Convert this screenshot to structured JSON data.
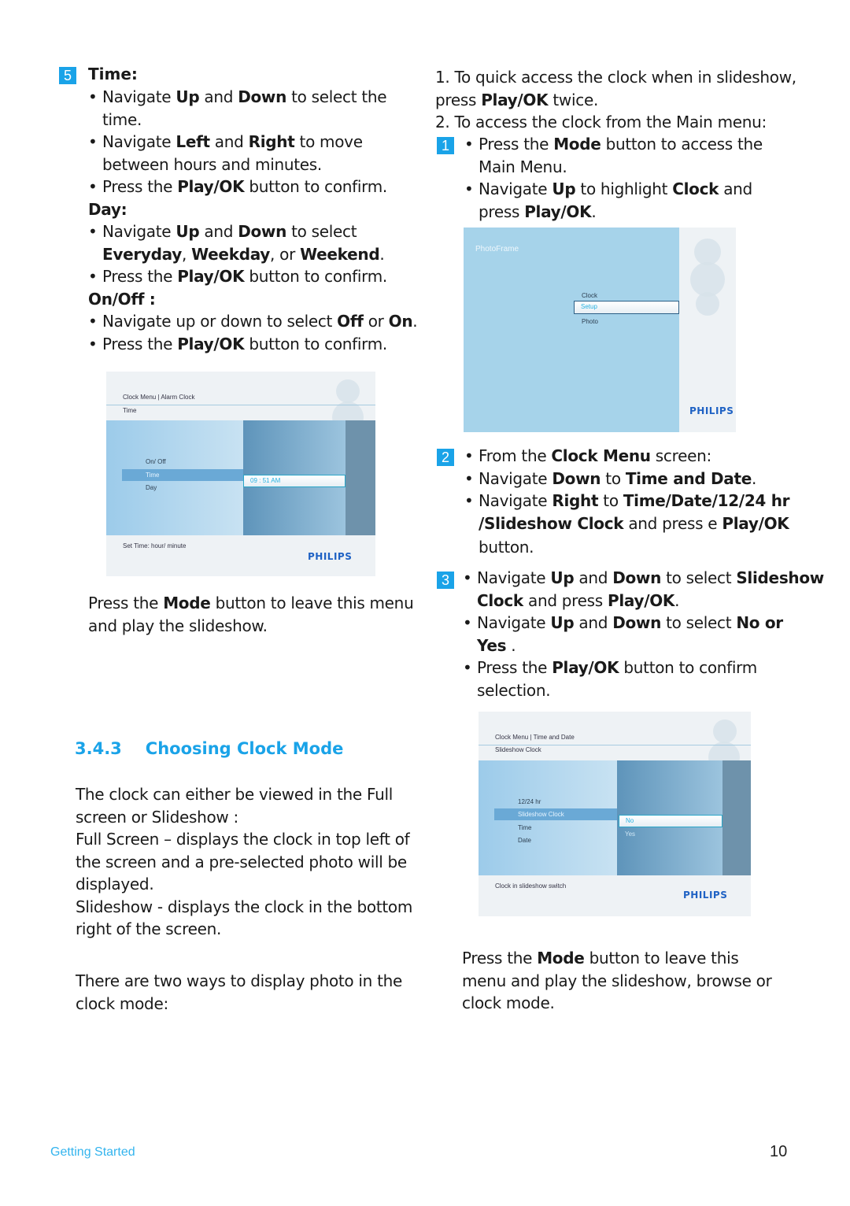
{
  "left": {
    "step5_badge": "5",
    "time_heading": "Time:",
    "time_items": [
      {
        "parts": [
          "Navigate ",
          "Up",
          " and ",
          "Down",
          " to select the"
        ],
        "cont": "time."
      },
      {
        "parts": [
          "Navigate ",
          "Left",
          " and ",
          "Right",
          " to move"
        ],
        "cont": "between hours and minutes."
      },
      {
        "parts": [
          "Press the ",
          "Play/OK",
          " button to confirm."
        ]
      }
    ],
    "day_heading": "Day:",
    "day_items": [
      {
        "parts": [
          "Navigate ",
          "Up",
          " and ",
          "Down",
          " to select"
        ],
        "cont_parts": [
          "Everyday",
          ", ",
          "Weekday",
          ", or ",
          "Weekend",
          "."
        ]
      },
      {
        "parts": [
          "Press the ",
          "Play/OK",
          " button to confirm."
        ]
      }
    ],
    "onoff_heading": "On/Off :",
    "onoff_items": [
      {
        "parts": [
          "Navigate up or down to select ",
          "Off",
          " or ",
          "On",
          "."
        ]
      },
      {
        "parts": [
          "Press the ",
          "Play/OK",
          " button to confirm."
        ]
      }
    ],
    "screen1": {
      "breadcrumb": "Clock Menu | Alarm Clock",
      "subtitle": "Time",
      "menu_items": [
        "On/ Off",
        "Time",
        "Day"
      ],
      "selected_item": "Time",
      "value": "09 : 51 AM",
      "footer": "Set Time: hour/ minute",
      "logo": "PHILIPS"
    },
    "leave_line1_parts": [
      "Press the ",
      "Mode",
      " button to leave this menu"
    ],
    "leave_line2": "and play the slideshow.",
    "section_number": "3.4.3",
    "section_title": "Choosing Clock Mode",
    "para1": [
      "The clock can either be viewed in the Full",
      "screen or Slideshow :",
      "Full Screen – displays the clock in top left of",
      "the screen and a pre-selected photo will be",
      "displayed.",
      "Slideshow  - displays the clock in the bottom",
      "right of the screen."
    ],
    "para2": [
      "There are two ways to display photo in the",
      "clock mode:"
    ]
  },
  "right": {
    "intro1a": "1. To quick access the clock when in slideshow,",
    "intro1b_parts": [
      "press ",
      "Play/OK",
      " twice."
    ],
    "intro2": "2. To access the clock from the Main menu:",
    "step1_badge": "1",
    "step1_items": [
      {
        "parts": [
          "Press the ",
          "Mode",
          " button to access the"
        ],
        "cont": "Main Menu."
      },
      {
        "parts": [
          "Navigate ",
          "Up",
          " to highlight ",
          "Clock",
          " and"
        ],
        "cont_parts": [
          "press ",
          "Play/OK",
          "."
        ]
      }
    ],
    "screen2": {
      "title": "PhotoFrame",
      "menu_items": [
        "Clock",
        "Setup",
        "Photo"
      ],
      "selected_item": "Setup",
      "logo": "PHILIPS"
    },
    "step2_badge": "2",
    "step2_items": [
      {
        "parts": [
          "From the ",
          "Clock Menu",
          " screen:"
        ]
      },
      {
        "parts": [
          "Navigate ",
          "Down",
          " to ",
          "Time and Date",
          "."
        ]
      },
      {
        "parts": [
          "Navigate ",
          "Right",
          " to ",
          "Time/Date/12/24 hr"
        ],
        "cont_parts": [
          "/Slideshow Clock",
          " and press e ",
          "Play/OK"
        ],
        "cont2": "button."
      }
    ],
    "step3_badge": "3",
    "step3_items": [
      {
        "parts": [
          "Navigate ",
          "Up",
          " and ",
          "Down",
          " to select ",
          "Slideshow"
        ],
        "cont_parts": [
          "Clock",
          " and press ",
          "Play/OK",
          "."
        ]
      },
      {
        "parts": [
          "Navigate ",
          "Up",
          " and ",
          "Down",
          " to select ",
          "No or"
        ],
        "cont_parts": [
          "Yes",
          " ."
        ]
      },
      {
        "parts": [
          "Press the ",
          "Play/OK",
          " button to confirm"
        ],
        "cont": "selection."
      }
    ],
    "screen3": {
      "breadcrumb": "Clock Menu | Time and Date",
      "subtitle": "Slideshow Clock",
      "menu_items": [
        "12/24 hr",
        "Slideshow Clock",
        "Time",
        "Date"
      ],
      "selected_item": "Slideshow Clock",
      "options": [
        "No",
        "Yes"
      ],
      "selected_option": "No",
      "footer": "Clock in slideshow switch",
      "logo": "PHILIPS"
    },
    "leave_line1_parts": [
      "Press the ",
      "Mode",
      " button to leave this"
    ],
    "leave_line2": "menu and play the slideshow, browse or",
    "leave_line3": "clock mode."
  },
  "footer": {
    "section": "Getting Started",
    "page_number": "10"
  },
  "colors": {
    "accent": "#1aa3e8",
    "philips_blue": "#1f62c4"
  }
}
